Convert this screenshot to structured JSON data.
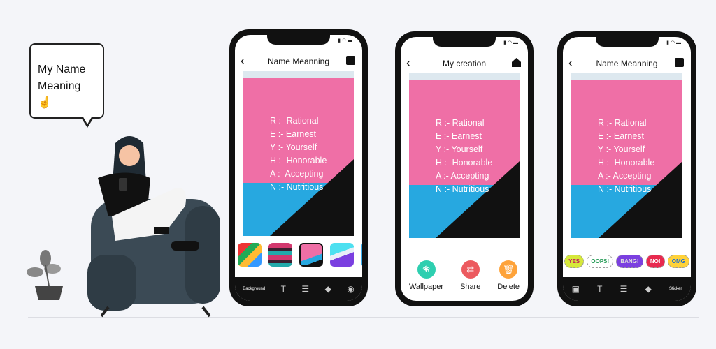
{
  "illustration": {
    "bubble_line1": "My Name",
    "bubble_line2": "Meaning",
    "icon": "pointing-hand-icon"
  },
  "names": [
    "R :- Rational",
    "E :- Earnest",
    "Y :- Yourself",
    "H :- Honorable",
    "A :- Accepting",
    "N :- Nutritious"
  ],
  "phone1": {
    "title": "Name Meanning",
    "back": "‹",
    "action_icon": "save-icon",
    "toolbar": {
      "background": "Background",
      "items": [
        "T",
        "☰",
        "◆",
        "◉"
      ]
    }
  },
  "phone2": {
    "title": "My creation",
    "back": "‹",
    "action_icon": "home-icon",
    "actions": [
      {
        "label": "Wallpaper",
        "icon": "❀",
        "color": "#2ecfb0"
      },
      {
        "label": "Share",
        "icon": "⇄",
        "color": "#ec5a5f"
      },
      {
        "label": "Delete",
        "icon": "🗑",
        "color": "#fea33a"
      }
    ]
  },
  "phone3": {
    "title": "Name Meanning",
    "back": "‹",
    "action_icon": "save-icon",
    "stickers": [
      "YES",
      "OOPS!",
      "BANG!",
      "NO!",
      "OMG"
    ],
    "toolbar": {
      "items": [
        "▣",
        "T",
        "☰",
        "◆"
      ],
      "sticker": "Sticker"
    }
  },
  "colors": {
    "pink": "#ef6fa6",
    "blue": "#27a8e0",
    "bar": "#111111"
  }
}
